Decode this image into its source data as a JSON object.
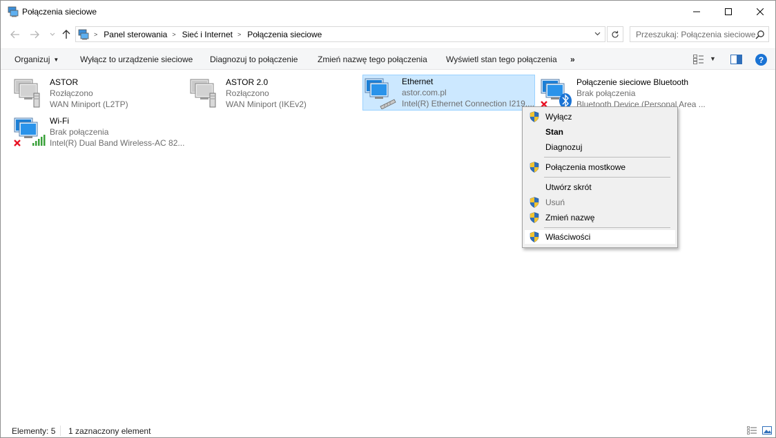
{
  "window": {
    "title": "Połączenia sieciowe"
  },
  "address_bar": {
    "breadcrumbs": [
      "Panel sterowania",
      "Sieć i Internet",
      "Połączenia sieciowe"
    ]
  },
  "search": {
    "placeholder": "Przeszukaj: Połączenia sieciowe"
  },
  "toolbar": {
    "organize": "Organizuj",
    "disable_device": "Wyłącz to urządzenie sieciowe",
    "diagnose": "Diagnozuj to połączenie",
    "rename": "Zmień nazwę tego połączenia",
    "show_status": "Wyświetl stan tego połączenia",
    "more": "»"
  },
  "connections": [
    {
      "name": "ASTOR",
      "status": "Rozłączono",
      "device": "WAN Miniport (L2TP)",
      "type": "wan"
    },
    {
      "name": "ASTOR 2.0",
      "status": "Rozłączono",
      "device": "WAN Miniport (IKEv2)",
      "type": "wan"
    },
    {
      "name": "Ethernet",
      "status": "astor.com.pl",
      "device": "Intel(R) Ethernet Connection I219....",
      "type": "ethernet",
      "selected": true
    },
    {
      "name": "Połączenie sieciowe Bluetooth",
      "status": "Brak połączenia",
      "device": "Bluetooth Device (Personal Area ...",
      "type": "bluetooth"
    },
    {
      "name": "Wi-Fi",
      "status": "Brak połączenia",
      "device": "Intel(R) Dual Band Wireless-AC 82...",
      "type": "wifi"
    }
  ],
  "context_menu": {
    "items": [
      {
        "label": "Wyłącz",
        "shield": true,
        "bold": false,
        "disabled": false
      },
      {
        "label": "Stan",
        "shield": false,
        "bold": true,
        "disabled": false
      },
      {
        "label": "Diagnozuj",
        "shield": false,
        "bold": false,
        "disabled": false
      },
      {
        "label": "Połączenia mostkowe",
        "shield": true,
        "bold": false,
        "disabled": false
      },
      {
        "label": "Utwórz skrót",
        "shield": false,
        "bold": false,
        "disabled": false
      },
      {
        "label": "Usuń",
        "shield": true,
        "bold": false,
        "disabled": true
      },
      {
        "label": "Zmień nazwę",
        "shield": true,
        "bold": false,
        "disabled": false
      },
      {
        "label": "Właściwości",
        "shield": true,
        "bold": false,
        "disabled": false,
        "hover": true
      }
    ]
  },
  "status_bar": {
    "count": "Elementy: 5",
    "selection": "1 zaznaczony element"
  },
  "colors": {
    "selection_bg": "#cce8ff",
    "selection_border": "#99d1ff",
    "help_blue": "#1a73d4",
    "error_red": "#e81123",
    "wifi_green": "#3aa13a"
  }
}
